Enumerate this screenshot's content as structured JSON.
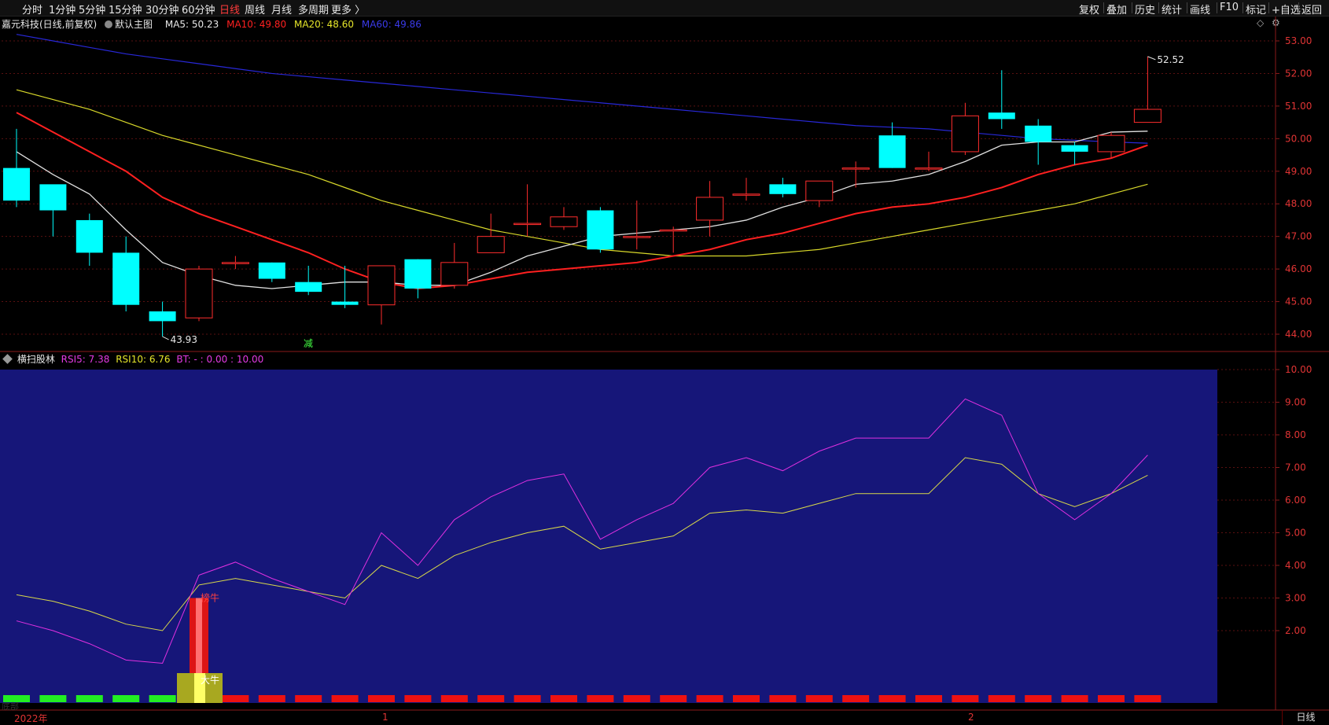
{
  "toolbar": {
    "periods": [
      "分时",
      "1分钟",
      "5分钟",
      "15分钟",
      "30分钟",
      "60分钟",
      "日线",
      "周线",
      "月线",
      "多周期",
      "更多 〉"
    ],
    "active_index": 6,
    "right_buttons": [
      "复权",
      "叠加",
      "历史",
      "统计",
      "画线",
      "F10",
      "标记",
      "+自选",
      "返回"
    ]
  },
  "main_info": {
    "title": "嘉元科技(日线,前复权)",
    "template": "默认主图",
    "ma5": "MA5: 50.23",
    "ma10": "MA10: 49.80",
    "ma20": "MA20: 48.60",
    "ma60": "MA60: 49.86",
    "colors": {
      "ma5": "#ffffff",
      "ma10": "#ff2020",
      "ma20": "#e6e62a",
      "ma60": "#2f2fe0"
    }
  },
  "sub_info": {
    "name": "横扫股林",
    "rsi5": "RSI5: 7.38",
    "rsi10": "RSI10: 6.76",
    "bt": "BT: - : 0.00 : 10.00",
    "colors": {
      "rsi5": "#e33ae3",
      "rsi10": "#e6e62a",
      "bt": "#e33ae3"
    }
  },
  "main_axis": {
    "ticks": [
      "53.00",
      "52.00",
      "51.00",
      "50.00",
      "49.00",
      "48.00",
      "47.00",
      "46.00",
      "45.00",
      "44.00"
    ],
    "min": 43.7,
    "max": 53.4
  },
  "sub_axis": {
    "ticks": [
      "10.00",
      "9.00",
      "8.00",
      "7.00",
      "6.00",
      "5.00",
      "4.00",
      "3.00",
      "2.00"
    ],
    "min": 0,
    "max": 10
  },
  "annotations": {
    "high": "52.52",
    "low": "43.93",
    "marker": "减",
    "sub_big": "榜牛",
    "sub_small": "大牛",
    "legend_cut": "底部"
  },
  "time_axis": [
    "2022年",
    "1",
    "2"
  ],
  "period_label": "日线",
  "chart_data": {
    "type": "candlestick",
    "candles": [
      {
        "o": 49.1,
        "c": 48.1,
        "h": 50.3,
        "l": 47.9
      },
      {
        "o": 48.6,
        "c": 47.8,
        "h": 48.4,
        "l": 47.0
      },
      {
        "o": 47.5,
        "c": 46.5,
        "h": 47.7,
        "l": 46.1
      },
      {
        "o": 46.5,
        "c": 44.9,
        "h": 47.0,
        "l": 44.7
      },
      {
        "o": 44.7,
        "c": 44.4,
        "h": 45.0,
        "l": 43.93
      },
      {
        "o": 44.5,
        "c": 46.0,
        "h": 46.1,
        "l": 44.4
      },
      {
        "o": 46.2,
        "c": 46.2,
        "h": 46.4,
        "l": 46.0
      },
      {
        "o": 46.2,
        "c": 45.7,
        "h": 46.2,
        "l": 45.6
      },
      {
        "o": 45.6,
        "c": 45.3,
        "h": 46.1,
        "l": 45.2
      },
      {
        "o": 45.0,
        "c": 44.9,
        "h": 46.1,
        "l": 44.8
      },
      {
        "o": 44.9,
        "c": 46.1,
        "h": 46.1,
        "l": 44.3
      },
      {
        "o": 46.3,
        "c": 45.4,
        "h": 46.3,
        "l": 45.1
      },
      {
        "o": 45.5,
        "c": 46.2,
        "h": 46.8,
        "l": 45.4
      },
      {
        "o": 46.5,
        "c": 47.0,
        "h": 47.7,
        "l": 46.5
      },
      {
        "o": 47.4,
        "c": 47.4,
        "h": 48.6,
        "l": 47.0
      },
      {
        "o": 47.3,
        "c": 47.6,
        "h": 47.9,
        "l": 47.2
      },
      {
        "o": 47.8,
        "c": 46.6,
        "h": 47.9,
        "l": 46.5
      },
      {
        "o": 47.0,
        "c": 47.0,
        "h": 48.1,
        "l": 46.6
      },
      {
        "o": 47.2,
        "c": 47.2,
        "h": 47.3,
        "l": 46.5
      },
      {
        "o": 47.5,
        "c": 48.2,
        "h": 48.7,
        "l": 47.0
      },
      {
        "o": 48.3,
        "c": 48.3,
        "h": 48.8,
        "l": 48.1
      },
      {
        "o": 48.6,
        "c": 48.3,
        "h": 48.8,
        "l": 48.2
      },
      {
        "o": 48.1,
        "c": 48.7,
        "h": 48.7,
        "l": 47.9
      },
      {
        "o": 49.1,
        "c": 49.1,
        "h": 49.3,
        "l": 48.5
      },
      {
        "o": 50.1,
        "c": 49.1,
        "h": 50.5,
        "l": 49.1
      },
      {
        "o": 49.1,
        "c": 49.1,
        "h": 49.6,
        "l": 49.0
      },
      {
        "o": 49.6,
        "c": 50.7,
        "h": 51.1,
        "l": 49.5
      },
      {
        "o": 50.8,
        "c": 50.6,
        "h": 52.1,
        "l": 50.3
      },
      {
        "o": 50.4,
        "c": 49.9,
        "h": 50.6,
        "l": 49.2
      },
      {
        "o": 49.8,
        "c": 49.6,
        "h": 49.9,
        "l": 49.2
      },
      {
        "o": 49.6,
        "c": 50.1,
        "h": 50.2,
        "l": 49.4
      },
      {
        "o": 50.5,
        "c": 50.9,
        "h": 52.52,
        "l": 50.5
      }
    ],
    "ma5": [
      49.6,
      48.9,
      48.3,
      47.2,
      46.2,
      45.8,
      45.5,
      45.4,
      45.5,
      45.6,
      45.6,
      45.5,
      45.5,
      45.9,
      46.4,
      46.7,
      47.0,
      47.1,
      47.2,
      47.3,
      47.5,
      47.9,
      48.2,
      48.6,
      48.7,
      48.9,
      49.3,
      49.8,
      49.9,
      49.9,
      50.2,
      50.23
    ],
    "ma10": [
      50.8,
      50.2,
      49.6,
      49.0,
      48.2,
      47.7,
      47.3,
      46.9,
      46.5,
      46.0,
      45.6,
      45.4,
      45.5,
      45.7,
      45.9,
      46.0,
      46.1,
      46.2,
      46.4,
      46.6,
      46.9,
      47.1,
      47.4,
      47.7,
      47.9,
      48.0,
      48.2,
      48.5,
      48.9,
      49.2,
      49.4,
      49.8
    ],
    "ma20": [
      51.5,
      51.2,
      50.9,
      50.5,
      50.1,
      49.8,
      49.5,
      49.2,
      48.9,
      48.5,
      48.1,
      47.8,
      47.5,
      47.2,
      47.0,
      46.8,
      46.6,
      46.5,
      46.4,
      46.4,
      46.4,
      46.5,
      46.6,
      46.8,
      47.0,
      47.2,
      47.4,
      47.6,
      47.8,
      48.0,
      48.3,
      48.6
    ],
    "ma60": [
      53.2,
      53.0,
      52.8,
      52.6,
      52.45,
      52.3,
      52.15,
      52.0,
      51.9,
      51.8,
      51.7,
      51.6,
      51.5,
      51.4,
      51.3,
      51.2,
      51.1,
      51.0,
      50.9,
      50.8,
      50.7,
      50.6,
      50.5,
      50.4,
      50.35,
      50.3,
      50.2,
      50.1,
      50.0,
      49.95,
      49.9,
      49.86
    ],
    "rsi5": [
      2.3,
      2.0,
      1.6,
      1.1,
      1.0,
      3.7,
      4.1,
      3.6,
      3.2,
      2.8,
      5.0,
      4.0,
      5.4,
      6.1,
      6.6,
      6.8,
      4.8,
      5.4,
      5.9,
      7.0,
      7.3,
      6.9,
      7.5,
      7.9,
      7.9,
      7.9,
      9.1,
      8.6,
      6.2,
      5.4,
      6.2,
      7.38
    ],
    "rsi10": [
      3.1,
      2.9,
      2.6,
      2.2,
      2.0,
      3.4,
      3.6,
      3.4,
      3.2,
      3.0,
      4.0,
      3.6,
      4.3,
      4.7,
      5.0,
      5.2,
      4.5,
      4.7,
      4.9,
      5.6,
      5.7,
      5.6,
      5.9,
      6.2,
      6.2,
      6.2,
      7.3,
      7.1,
      6.2,
      5.8,
      6.2,
      6.76
    ],
    "bottom_bars": [
      "g",
      "g",
      "g",
      "g",
      "g",
      "y",
      "r",
      "r",
      "r",
      "r",
      "r",
      "r",
      "r",
      "r",
      "r",
      "r",
      "r",
      "r",
      "r",
      "r",
      "r",
      "r",
      "r",
      "r",
      "r",
      "r",
      "r",
      "r",
      "r",
      "r",
      "r",
      "r"
    ]
  }
}
